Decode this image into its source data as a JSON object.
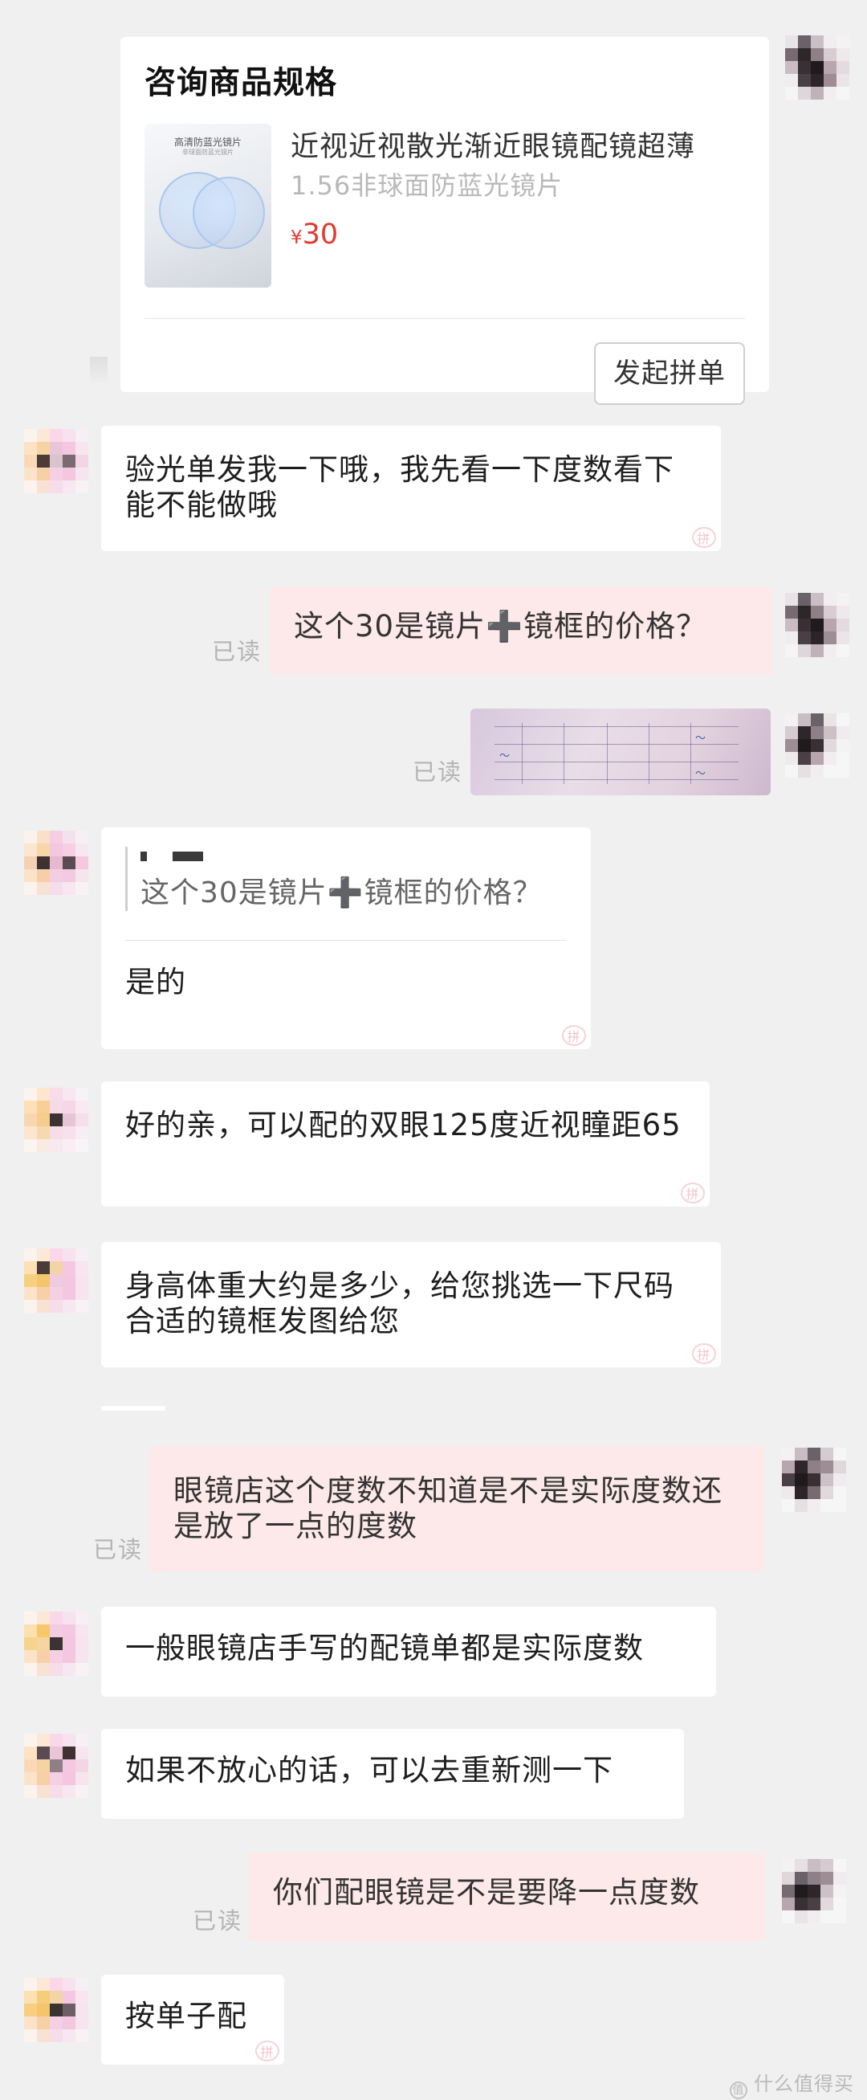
{
  "product_card": {
    "title": "咨询商品规格",
    "image_label": "高清防蓝光镜片",
    "image_sub": "非球面防蓝光镜片",
    "name": "近视近视散光渐近眼镜配镜超薄",
    "spec": "1.56非球面防蓝光镜片",
    "currency": "¥",
    "price": "30",
    "action_label": "发起拼单"
  },
  "read_label": "已读",
  "messages": {
    "m1": {
      "text": "验光单发我一下哦，我先看一下度数看下能不能做哦"
    },
    "m2": {
      "text": "这个30是镜片➕镜框的价格？"
    },
    "m4": {
      "quote": "这个30是镜片➕镜框的价格？",
      "text": "是的"
    },
    "m5": {
      "text": "好的亲，可以配的双眼125度近视瞳距65"
    },
    "m6": {
      "text": "身高体重大约是多少，给您挑选一下尺码合适的镜框发图给您"
    },
    "m7": {
      "text": "眼镜店这个度数不知道是不是实际度数还是放了一点的度数"
    },
    "m8": {
      "text": "一般眼镜店手写的配镜单都是实际度数"
    },
    "m9": {
      "text": "如果不放心的话，可以去重新测一下"
    },
    "m10": {
      "text": "你们配眼镜是不是要降一点度数"
    },
    "m11": {
      "text": "按单子配"
    }
  },
  "watermark": {
    "icon": "值",
    "text": "什么值得买"
  },
  "colors": {
    "background": "#f0f0f0",
    "incoming_bubble": "#ffffff",
    "outgoing_bubble": "#fde9e9",
    "price": "#e4392f",
    "read_label": "#b4b4b4"
  }
}
